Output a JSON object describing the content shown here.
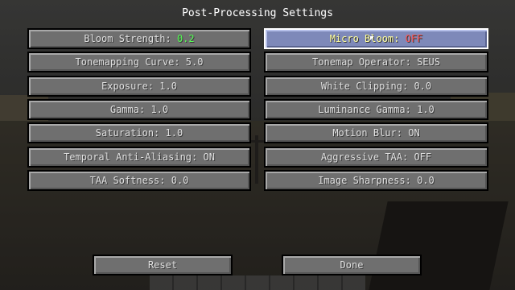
{
  "screen": {
    "title": "Post-Processing Settings"
  },
  "left_options": [
    {
      "label": "Bloom Strength: ",
      "value": "0.2",
      "value_color": "green"
    },
    {
      "label": "Tonemapping Curve: ",
      "value": "5.0",
      "value_color": ""
    },
    {
      "label": "Exposure: ",
      "value": "1.0",
      "value_color": ""
    },
    {
      "label": "Gamma: ",
      "value": "1.0",
      "value_color": ""
    },
    {
      "label": "Saturation: ",
      "value": "1.0",
      "value_color": ""
    },
    {
      "label": "Temporal Anti-Aliasing: ",
      "value": "ON",
      "value_color": ""
    },
    {
      "label": "TAA Softness: ",
      "value": "0.0",
      "value_color": ""
    }
  ],
  "right_options": [
    {
      "label": "Micro Bloom: ",
      "value": "OFF",
      "value_color": "red",
      "hovered": true
    },
    {
      "label": "Tonemap Operator: ",
      "value": "SEUS",
      "value_color": ""
    },
    {
      "label": "White Clipping: ",
      "value": "0.0",
      "value_color": ""
    },
    {
      "label": "Luminance Gamma: ",
      "value": "1.0",
      "value_color": ""
    },
    {
      "label": "Motion Blur: ",
      "value": "ON",
      "value_color": ""
    },
    {
      "label": "Aggressive TAA: ",
      "value": "OFF",
      "value_color": ""
    },
    {
      "label": "Image Sharpness: ",
      "value": "0.0",
      "value_color": ""
    }
  ],
  "footer": {
    "reset_label": "Reset",
    "done_label": "Done"
  },
  "colors": {
    "green": "#55ff55",
    "red": "#ff5555",
    "button": "#6f6f6f",
    "hover": "#7e89b9"
  }
}
